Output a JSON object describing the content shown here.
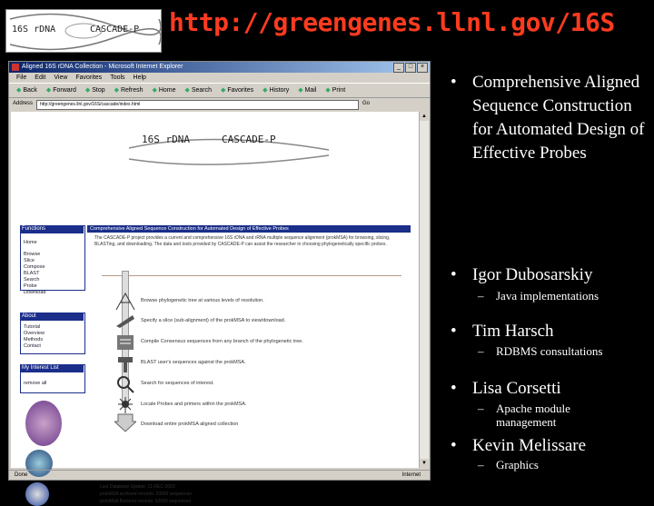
{
  "slide": {
    "title": "http://greengenes.llnl.gov/16S",
    "logo": {
      "left": "16S rDNA",
      "right": "CASCADE-P"
    }
  },
  "browser": {
    "window_title": "Aligned 16S rDNA Collection - Microsoft Internet Explorer",
    "window_buttons": [
      "_",
      "□",
      "×"
    ],
    "menu": [
      "File",
      "Edit",
      "View",
      "Favorites",
      "Tools",
      "Help"
    ],
    "toolbar": [
      "Back",
      "Forward",
      "Stop",
      "Refresh",
      "Home",
      "Search",
      "Favorites",
      "History",
      "Mail",
      "Print"
    ],
    "address_label": "Address",
    "address_value": "http://greengenes.llnl.gov/16S/cascade/index.html",
    "go_label": "Go",
    "status": {
      "left": "Done",
      "right": "Internet"
    }
  },
  "page": {
    "logo": {
      "left": "16S rDNA",
      "right": "CASCADE-P"
    },
    "sidebar": {
      "functions_head": "Functions",
      "functions": [
        "Home",
        "Browse",
        "Slice",
        "Compose",
        "BLAST",
        "Search",
        "Probe",
        "Download"
      ],
      "about_head": "About",
      "about": [
        "Tutorial",
        "Overview",
        "Methods",
        "Contact"
      ],
      "interest_head": "My Interest List",
      "interest": [
        "remove all"
      ]
    },
    "main_head": "Comprehensive Aligned Sequence Construction for Automated Design of Effective Probes",
    "intro": "The CASCADE-P project provides a current and comprehensive 16S rDNA and rRNA multiple sequence alignment (prokMSA) for browsing, slicing, BLASTing, and downloading. The data and tools provided by CASCADE-P can assist the researcher in choosing phylogenetically specific probes.",
    "features": [
      "Browse phylogenetic tree at various levels of resolution.",
      "Specify a slice (sub-alignment) of the prokMSA to view/download.",
      "Compile Consensus sequences from any branch of the phylogenetic tree.",
      "BLAST user's sequences against the prokMSA.",
      "Search for sequences of interest.",
      "Locate Probes and primers within the prokMSA.",
      "Download entire prokMSA aligned collection"
    ],
    "stats": [
      "Last Database Update: 11-DEC-2003",
      "prokMSA archived records: 23000 sequences",
      "prokMSA Bacteria records: 62000 sequences"
    ]
  },
  "bullets": [
    {
      "text": "Comprehensive Aligned Sequence Construction for Automated Design of Effective Probes",
      "subs": []
    },
    {
      "text": "Igor Dubosarskiy",
      "subs": [
        "Java implementations"
      ]
    },
    {
      "text": "Tim Harsch",
      "subs": [
        "RDBMS consultations"
      ]
    },
    {
      "text": "Lisa Corsetti",
      "subs": [
        "Apache module management"
      ]
    },
    {
      "text": "Kevin Melissare",
      "subs": [
        "Graphics"
      ]
    }
  ],
  "colors": {
    "title": "#ff3b1f",
    "nav_blue": "#1a2e8a",
    "slide_bg": "#000000"
  }
}
